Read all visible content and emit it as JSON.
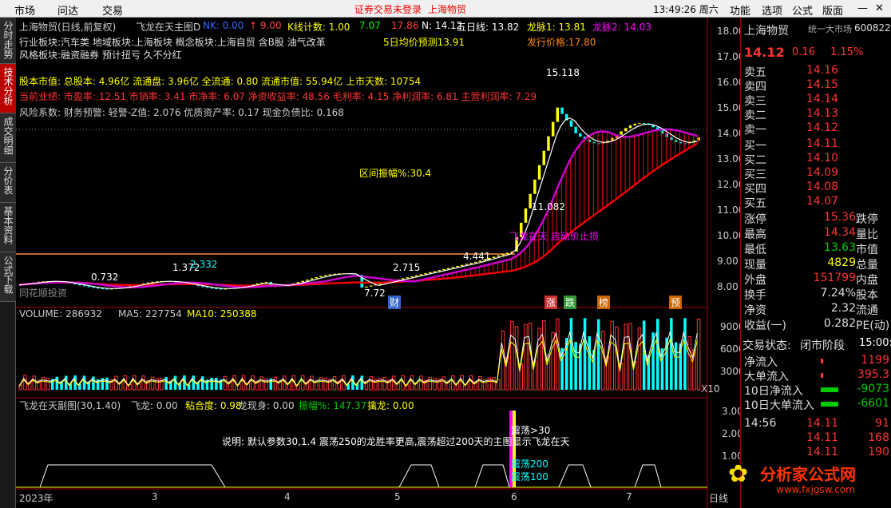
{
  "menu": {
    "market": "市场",
    "wenda": "问达",
    "trade": "交易",
    "login_status": "证券交易未登录",
    "stock_name": "上海物贸",
    "clock": "13:49:26 周六",
    "func": "功能",
    "options": "选项",
    "formula": "公式",
    "layout": "版面"
  },
  "side_tabs": [
    "分时走势",
    "技术分析",
    "成交明细",
    "分价表",
    "基本资料",
    "公式下载"
  ],
  "header": {
    "title": "上海物贸(日线,前复权)",
    "indicator": "飞龙在天主图D",
    "nk": "NK: 0.00",
    "up": "↑ 9.00",
    "kcount": "K线计数: 1.00",
    "kcount_v1": "7.07",
    "kcount_v2": "17.86",
    "n": "N: 14.12",
    "ma5": "五日线: 13.82",
    "dragon1": "龙脉1: 13.81",
    "dragon2": "龙脉2: 14.03"
  },
  "info": {
    "line1": "行业板块:汽车类 地域板块:上海板块 概念板块:上海自贸 含B股 油气改革",
    "line2": "风格板块:融资融券 预计扭亏 久不分红",
    "line3": "股本市值: 总股本: 4.96亿 流通盘: 3.96亿 全流通: 0.80 流通市值: 55.94亿 上市天数: 10754",
    "line4": "当前业绩: 市盈率: 12.51 市销率: 3.41 市净率: 6.07 净资收益率: 48.56 毛利率: 4.15 净利润率: 6.81 主营利润率: 7.29",
    "line5": "风险系数: 财务预警: 轻警-Z值: 2.076 优质资产率: 0.17 现金负债比: 0.168"
  },
  "annotations": {
    "forecast": "5日均价预测13.91",
    "issue": "发行价格:17.80",
    "high": "15.118",
    "range": "区间振幅%:30.4",
    "val1": "11.082",
    "val2": "4.441",
    "val3": "2.715",
    "val4": "1.372",
    "val5": "2.332",
    "val6": "0.732",
    "val7": "7.72",
    "stop": "飞龙在天 启动价止损",
    "watermark": "同花顺投资",
    "markers": [
      "财",
      "涨",
      "跌",
      "榜",
      "预"
    ]
  },
  "price_axis": [
    "18.00",
    "17.00",
    "16.00",
    "15.00",
    "14.00",
    "13.00",
    "12.00",
    "11.00",
    "10.00",
    "9.00",
    "8.00"
  ],
  "volume": {
    "vol": "VOLUME: 286932",
    "ma5": "MA5: 227754",
    "ma10": "MA10: 250388",
    "axis": [
      "90000",
      "60000",
      "30000"
    ],
    "x10": "X10"
  },
  "sub": {
    "title": "飞龙在天副图(30,1.40)",
    "feilong": "飞龙: 0.00",
    "nianhe": "粘合度: 0.98",
    "longxian": "龙现身: 0.00",
    "zhenfu": "振幅%: 147.37",
    "qinlong": "擒龙: 0.00",
    "axis": [
      "3.00",
      "2.00",
      "1.00"
    ],
    "note": "说明: 默认参数30,1.4 震荡250的龙胜率更高,震荡超过200天的主图显示飞龙在天",
    "z30": "震荡>30",
    "z200": "震荡200",
    "z100": "震荡100"
  },
  "xaxis": {
    "labels": [
      "2023年",
      "3",
      "4",
      "5",
      "6",
      "7"
    ],
    "date_label": "日线"
  },
  "right": {
    "name": "上海物贸",
    "market": "统一大市场",
    "code": "600822",
    "price": "14.12",
    "change": "0.16",
    "pct": "1.15%",
    "asks": [
      {
        "label": "卖五",
        "price": "14.16"
      },
      {
        "label": "卖四",
        "price": "14.15"
      },
      {
        "label": "卖三",
        "price": "14.14"
      },
      {
        "label": "卖二",
        "price": "14.13"
      },
      {
        "label": "卖一",
        "price": "14.12"
      }
    ],
    "bids": [
      {
        "label": "买一",
        "price": "14.11"
      },
      {
        "label": "买二",
        "price": "14.10"
      },
      {
        "label": "买三",
        "price": "14.09"
      },
      {
        "label": "买四",
        "price": "14.08"
      },
      {
        "label": "买五",
        "price": "14.07"
      }
    ],
    "stats": [
      {
        "l1": "涨停",
        "v1": "15.36",
        "l2": "跌停"
      },
      {
        "l1": "最高",
        "v1": "14.34",
        "l2": "量比"
      },
      {
        "l1": "最低",
        "v1": "13.63",
        "l2": "市值"
      },
      {
        "l1": "现量",
        "v1": "4829",
        "l2": "总量"
      },
      {
        "l1": "外盘",
        "v1": "151799",
        "l2": "内盘"
      }
    ],
    "stats2": [
      {
        "l1": "换手",
        "v1": "7.24%",
        "l2": "股本"
      },
      {
        "l1": "净资",
        "v1": "2.32",
        "l2": "流通"
      },
      {
        "l1": "收益(一)",
        "v1": "0.282",
        "l2": "PE(动)"
      }
    ],
    "status_label": "交易状态:",
    "status": "闭市阶段",
    "status_time": "15:00:",
    "flows": [
      {
        "l": "净流入",
        "v": "1199"
      },
      {
        "l": "大单流入",
        "v": "395.3"
      },
      {
        "l": "10日净流入",
        "v": "-9073"
      },
      {
        "l": "10日大单流入",
        "v": "-6601"
      }
    ],
    "ticks": [
      {
        "t": "14:56",
        "p": "14.11",
        "v": "91"
      },
      {
        "t": "",
        "p": "14.11",
        "v": "168"
      },
      {
        "t": "",
        "p": "14.11",
        "v": "190"
      }
    ],
    "logo": "分析家公式网",
    "logo_url": "www.fxjgsw.com"
  }
}
